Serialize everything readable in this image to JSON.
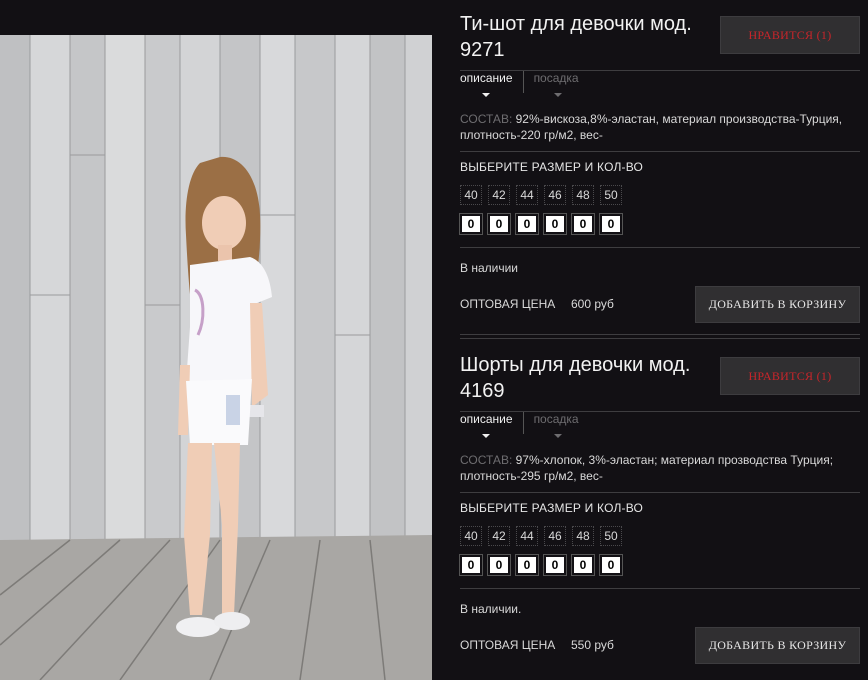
{
  "products": [
    {
      "title": "Ти-шот для девочки мод. 9271",
      "like_label": "НРАВИТСЯ (1)",
      "tabs": [
        {
          "label": "описание"
        },
        {
          "label": "посадка"
        }
      ],
      "composition_label": "СОСТАВ:",
      "composition_text": " 92%-вискоза,8%-эластан, материал производства-Турция, плотность-220 гр/м2, вес-",
      "size_heading": "ВЫБЕРИТЕ РАЗМЕР И КОЛ-ВО",
      "sizes": [
        "40",
        "42",
        "44",
        "46",
        "48",
        "50"
      ],
      "quantities": [
        "0",
        "0",
        "0",
        "0",
        "0",
        "0"
      ],
      "stock": "В наличии",
      "price_label": "ОПТОВАЯ ЦЕНА",
      "price": "600 руб",
      "cart_label": "ДОБАВИТЬ В КОРЗИНУ"
    },
    {
      "title": "Шорты для девочки мод. 4169",
      "like_label": "НРАВИТСЯ (1)",
      "tabs": [
        {
          "label": "описание"
        },
        {
          "label": "посадка"
        }
      ],
      "composition_label": "СОСТАВ:",
      "composition_text": " 97%-хлопок, 3%-эластан; материал прозводства Турция; плотность-295 гр/м2, вес-",
      "size_heading": "ВЫБЕРИТЕ РАЗМЕР И КОЛ-ВО",
      "sizes": [
        "40",
        "42",
        "44",
        "46",
        "48",
        "50"
      ],
      "quantities": [
        "0",
        "0",
        "0",
        "0",
        "0",
        "0"
      ],
      "stock": "В наличии.",
      "price_label": "ОПТОВАЯ ЦЕНА",
      "price": "550 руб",
      "cart_label": "ДОБАВИТЬ В КОРЗИНУ"
    }
  ],
  "colors": {
    "background": "#121014",
    "button_bg": "#302f31",
    "like_text": "#c8252a",
    "muted": "#6e6d70"
  }
}
